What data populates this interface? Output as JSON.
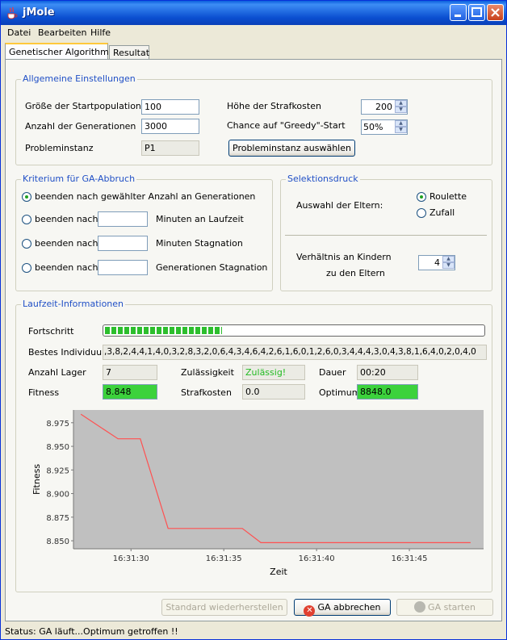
{
  "window": {
    "title": "jMole"
  },
  "menu": [
    "Datei",
    "Bearbeiten",
    "Hilfe"
  ],
  "tabs": [
    {
      "label": "Genetischer Algorithmus",
      "active": true
    },
    {
      "label": "Resultat",
      "active": false
    }
  ],
  "general": {
    "legend": "Allgemeine Einstellungen",
    "start_population_label": "Größe der Startpopulation",
    "start_population": "100",
    "generations_label": "Anzahl der Generationen",
    "generations": "3000",
    "instance_label": "Probleminstanz",
    "instance": "P1",
    "penalty_label": "Höhe der Strafkosten",
    "penalty": "200",
    "greedy_label": "Chance auf \"Greedy\"-Start",
    "greedy": "50%",
    "select_instance_button": "Probleminstanz auswählen"
  },
  "abort": {
    "legend": "Kriterium für GA-Abbruch",
    "option1": "beenden nach gewählter Anzahl an Generationen",
    "option2": "beenden nach",
    "option2_suffix": "Minuten an Laufzeit",
    "option3": "beenden nach",
    "option3_suffix": "Minuten Stagnation",
    "option4": "beenden nach",
    "option4_suffix": "Generationen Stagnation",
    "selected": 1
  },
  "selection": {
    "legend": "Selektionsdruck",
    "parents_label": "Auswahl der Eltern:",
    "roulette": "Roulette",
    "random": "Zufall",
    "selected": "Roulette",
    "ratio_label_1": "Verhältnis an Kindern",
    "ratio_label_2": "zu den Eltern",
    "ratio": "4"
  },
  "runtime": {
    "legend": "Laufzeit-Informationen",
    "progress_label": "Fortschritt",
    "progress_fraction": 0.31,
    "best_label": "Bestes Individuum",
    "best": ",3,8,2,4,4,1,4,0,3,2,8,3,2,0,6,4,3,4,6,4,2,6,1,6,0,1,2,6,0,3,4,4,4,3,0,4,3,8,1,6,4,0,2,0,4,0",
    "stock_label": "Anzahl Lager",
    "stock": "7",
    "valid_label": "Zulässigkeit",
    "valid": "Zulässig!",
    "duration_label": "Dauer",
    "duration": "00:20",
    "fitness_label": "Fitness",
    "fitness": "8.848",
    "penalty_label": "Strafkosten",
    "penalty": "0.0",
    "optimum_label": "Optimum",
    "optimum": "8848.0"
  },
  "chart_data": {
    "type": "line",
    "xlabel": "Zeit",
    "ylabel": "Fitness",
    "x_ticks": [
      "16:31:30",
      "16:31:35",
      "16:31:40",
      "16:31:45"
    ],
    "y_ticks": [
      "8.975",
      "8.950",
      "8.925",
      "8.900",
      "8.875",
      "8.850"
    ],
    "xlim": [
      "16:31:26.9",
      "16:31:49.0"
    ],
    "ylim": [
      8.8415,
      8.9885
    ],
    "series": [
      {
        "color": "#ff5050",
        "x": [
          "16:31:27.3",
          "16:31:29.3",
          "16:31:30.5",
          "16:31:32.0",
          "16:31:36.0",
          "16:31:37.0",
          "16:31:48.3"
        ],
        "y": [
          8.984,
          8.958,
          8.958,
          8.863,
          8.863,
          8.848,
          8.848
        ]
      }
    ],
    "grid": false,
    "background": "#c0c0c0"
  },
  "buttons": {
    "restore": "Standard wiederherstellen",
    "abort": "GA abbrechen",
    "start": "GA starten"
  },
  "status": "Status:  GA läuft...Optimum getroffen !!"
}
